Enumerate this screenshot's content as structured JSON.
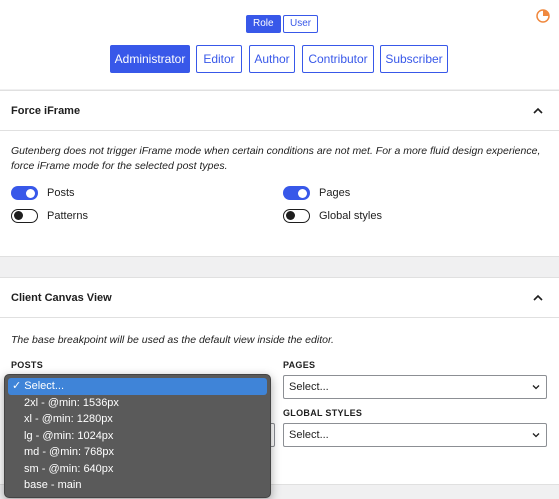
{
  "header": {
    "tabs": [
      "Role",
      "User"
    ],
    "roles": [
      "Administrator",
      "Editor",
      "Author",
      "Contributor",
      "Subscriber"
    ]
  },
  "force_iframe": {
    "title": "Force iFrame",
    "description": "Gutenberg does not trigger iFrame mode when certain conditions are not met. For a more fluid design experience, force iFrame mode for the selected post types.",
    "toggles": [
      {
        "label": "Posts",
        "on": true
      },
      {
        "label": "Pages",
        "on": true
      },
      {
        "label": "Patterns",
        "on": false
      },
      {
        "label": "Global styles",
        "on": false
      }
    ]
  },
  "client_canvas": {
    "title": "Client Canvas View",
    "description": "The base breakpoint will be used as the default view inside the editor.",
    "posts_label": "POSTS",
    "pages_label": "PAGES",
    "global_styles_label": "GLOBAL STYLES",
    "pages_value": "Select...",
    "global_styles_value": "Select...",
    "patterns_value": "Select..."
  },
  "dropdown": {
    "selected_check": "✓",
    "options": [
      "Select...",
      "2xl - @min: 1536px",
      "xl - @min: 1280px",
      "lg - @min: 1024px",
      "md - @min: 768px",
      "sm - @min: 640px",
      "base - main"
    ]
  },
  "colors": {
    "accent": "#3858e9",
    "logo": "#f0883e"
  }
}
